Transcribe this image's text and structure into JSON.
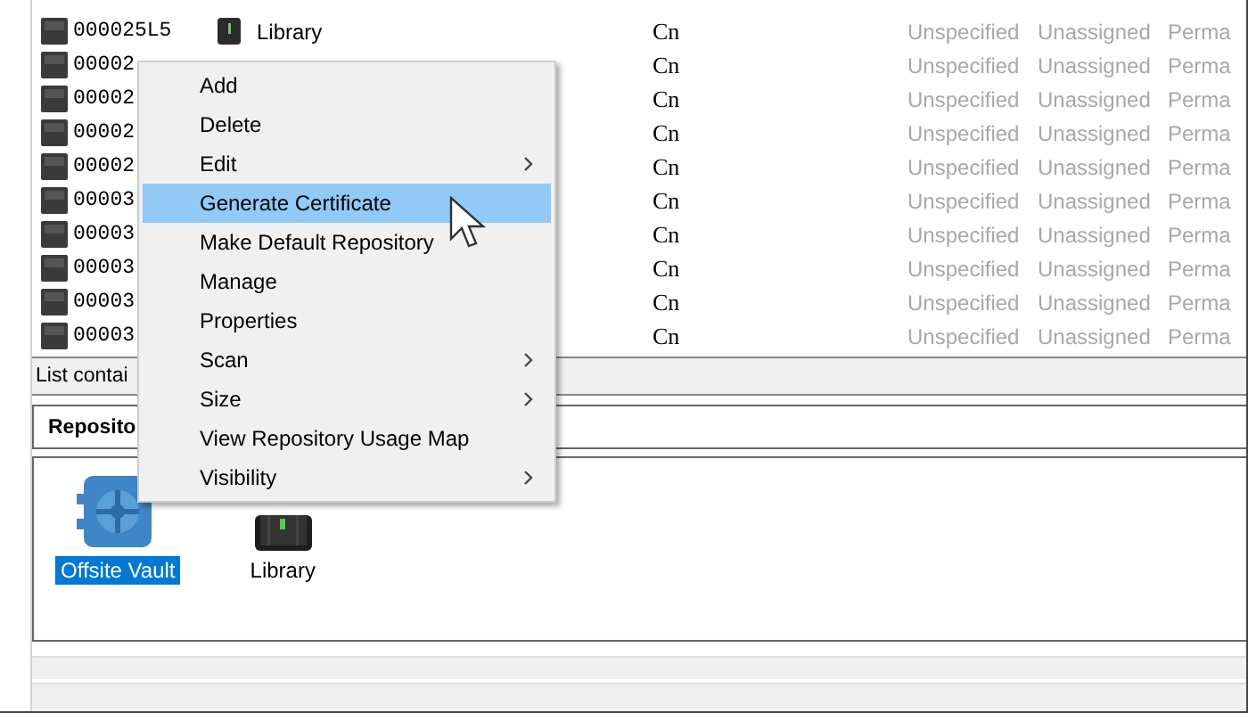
{
  "list": {
    "rows": [
      {
        "column_1": "000025L5",
        "column_2": "Library",
        "column_3": "Cn",
        "column_4": "Unspecified",
        "column_5": "Unassigned",
        "column_6": "Perma"
      },
      {
        "column_1": "00002",
        "column_3": "Cn",
        "column_4": "Unspecified",
        "column_5": "Unassigned",
        "column_6": "Perma"
      },
      {
        "column_1": "00002",
        "column_3": "Cn",
        "column_4": "Unspecified",
        "column_5": "Unassigned",
        "column_6": "Perma"
      },
      {
        "column_1": "00002",
        "column_3": "Cn",
        "column_4": "Unspecified",
        "column_5": "Unassigned",
        "column_6": "Perma"
      },
      {
        "column_1": "00002",
        "column_3": "Cn",
        "column_4": "Unspecified",
        "column_5": "Unassigned",
        "column_6": "Perma"
      },
      {
        "column_1": "00003",
        "column_3": "Cn",
        "column_4": "Unspecified",
        "column_5": "Unassigned",
        "column_6": "Perma"
      },
      {
        "column_1": "00003",
        "column_3": "Cn",
        "column_4": "Unspecified",
        "column_5": "Unassigned",
        "column_6": "Perma"
      },
      {
        "column_1": "00003",
        "column_3": "Cn",
        "column_4": "Unspecified",
        "column_5": "Unassigned",
        "column_6": "Perma"
      },
      {
        "column_1": "00003",
        "column_3": "Cn",
        "column_4": "Unspecified",
        "column_5": "Unassigned",
        "column_6": "Perma"
      },
      {
        "column_1": "00003",
        "column_3": "Cn",
        "column_4": "Unspecified",
        "column_5": "Unassigned",
        "column_6": "Perma"
      }
    ]
  },
  "status_bar": "List contai",
  "repositories": {
    "header": "Reposito",
    "items": [
      {
        "label": "Offsite Vault",
        "kind": "vault",
        "selected": true
      },
      {
        "label": "Library",
        "kind": "library",
        "selected": false
      }
    ]
  },
  "context_menu": [
    {
      "label": "Add",
      "submenu": false,
      "selected": false
    },
    {
      "label": "Delete",
      "submenu": false,
      "selected": false
    },
    {
      "label": "Edit",
      "submenu": true,
      "selected": false
    },
    {
      "label": "Generate Certificate",
      "submenu": false,
      "selected": true
    },
    {
      "label": "Make Default Repository",
      "submenu": false,
      "selected": false
    },
    {
      "label": "Manage",
      "submenu": false,
      "selected": false
    },
    {
      "label": "Properties",
      "submenu": false,
      "selected": false
    },
    {
      "label": "Scan",
      "submenu": true,
      "selected": false
    },
    {
      "label": "Size",
      "submenu": true,
      "selected": false
    },
    {
      "label": "View Repository Usage Map",
      "submenu": false,
      "selected": false
    },
    {
      "label": "Visibility",
      "submenu": true,
      "selected": false
    }
  ]
}
